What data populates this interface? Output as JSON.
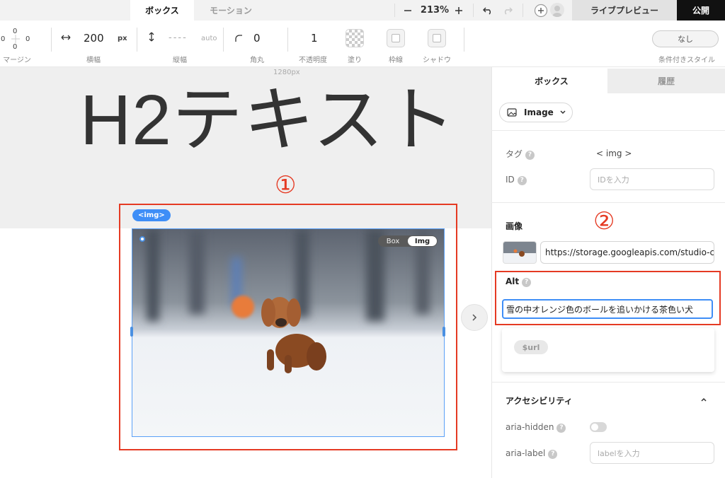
{
  "topbar": {
    "tabs": [
      "ボックス",
      "モーション"
    ],
    "zoom": "213%",
    "zoom_out": "−",
    "zoom_in": "+",
    "preview_label": "ライブプレビュー",
    "publish_label": "公開"
  },
  "toolbar": {
    "margin_top": "0",
    "margin_left": "0",
    "margin_right": "0",
    "margin_bottom": "0",
    "margin_label": "マージン",
    "width_value": "200",
    "width_unit": "px",
    "width_label": "横幅",
    "height_value": "----",
    "height_unit": "auto",
    "height_label": "縦幅",
    "radius_value": "0",
    "radius_label": "角丸",
    "opacity_value": "1",
    "opacity_label": "不透明度",
    "fill_label": "塗り",
    "border_label": "枠線",
    "shadow_label": "シャドウ",
    "conditional_value": "なし",
    "conditional_label": "条件付きスタイル"
  },
  "canvas": {
    "width_label": "1280px",
    "heading_text": "H2テキスト",
    "marker_1": "①",
    "img_tag": "<img>",
    "segment": [
      "Box",
      "Img"
    ]
  },
  "panel": {
    "tabs": [
      "ボックス",
      "履歴"
    ],
    "element_type": "Image",
    "tag_label": "タグ",
    "tag_value": "< img >",
    "id_label": "ID",
    "id_placeholder": "IDを入力",
    "image_label": "画像",
    "marker_2": "②",
    "image_url": "https://storage.googleapis.com/studio-c",
    "alt_label": "Alt",
    "alt_value": "雪の中オレンジ色のボールを追いかける茶色い犬",
    "suggestion_chip": "$url",
    "accessibility_label": "アクセシビリティ",
    "aria_hidden_label": "aria-hidden",
    "aria_hidden_on": false,
    "aria_label_label": "aria-label",
    "aria_label_placeholder": "labelを入力"
  },
  "colors": {
    "accent": "#3e8ef7",
    "annotation": "#e53a23",
    "publish_bg": "#111111"
  },
  "icons": [
    "minus-icon",
    "plus-icon",
    "undo-icon",
    "redo-icon",
    "add-circle-icon",
    "user-avatar-icon",
    "width-arrows-icon",
    "height-arrows-icon",
    "corner-radius-icon",
    "image-icon",
    "chevron-down-icon",
    "chevron-right-icon",
    "chevron-up-icon",
    "help-icon"
  ]
}
